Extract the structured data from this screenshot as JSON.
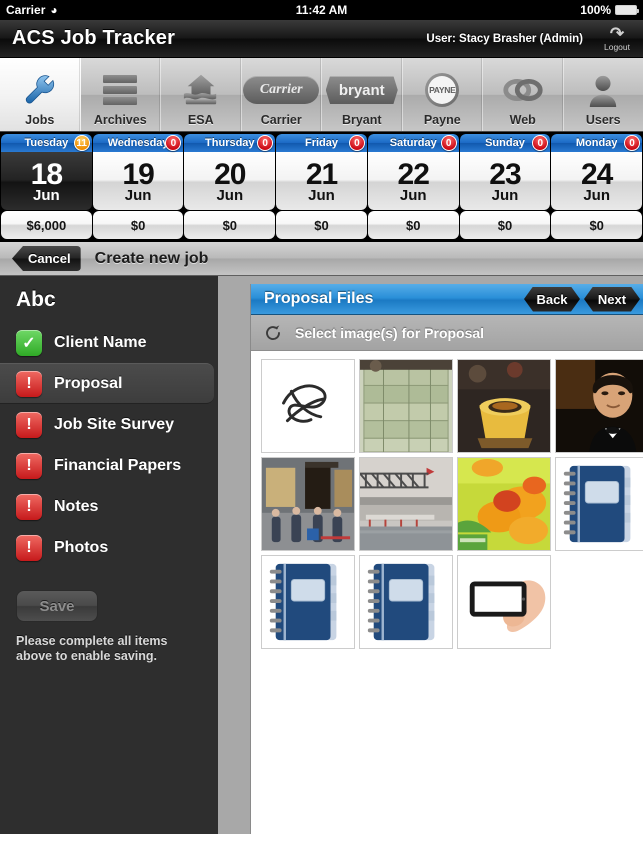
{
  "status_bar": {
    "carrier": "Carrier",
    "wifi_icon": "wifi-icon",
    "time": "11:42 AM",
    "battery_percent": "100%",
    "battery_icon": "battery-full-icon"
  },
  "app_bar": {
    "title": "ACS Job Tracker",
    "user": "User: Stacy Brasher (Admin)",
    "logout_label": "Logout",
    "logout_icon": "logout-icon"
  },
  "tabs": [
    {
      "label": "Jobs",
      "icon": "wrench-icon",
      "selected": true
    },
    {
      "label": "Archives",
      "icon": "archive-stack-icon",
      "selected": false
    },
    {
      "label": "ESA",
      "icon": "house-icon",
      "selected": false
    },
    {
      "label": "Carrier",
      "icon": "carrier-logo-icon",
      "selected": false,
      "logo_text": "Carrier"
    },
    {
      "label": "Bryant",
      "icon": "bryant-logo-icon",
      "selected": false,
      "logo_text": "bryant"
    },
    {
      "label": "Payne",
      "icon": "payne-logo-icon",
      "selected": false,
      "logo_text": "PAYNE"
    },
    {
      "label": "Web",
      "icon": "link-rings-icon",
      "selected": false
    },
    {
      "label": "Users",
      "icon": "person-icon",
      "selected": false
    }
  ],
  "days": [
    {
      "name": "Tuesday",
      "badge": "11",
      "badge_color": "#ef8f05",
      "num": "18",
      "month": "Jun",
      "amount": "$6,000",
      "active": true
    },
    {
      "name": "Wednesday",
      "badge": "0",
      "badge_color": "#cc0c17",
      "num": "19",
      "month": "Jun",
      "amount": "$0",
      "active": false
    },
    {
      "name": "Thursday",
      "badge": "0",
      "badge_color": "#cc0c17",
      "num": "20",
      "month": "Jun",
      "amount": "$0",
      "active": false
    },
    {
      "name": "Friday",
      "badge": "0",
      "badge_color": "#cc0c17",
      "num": "21",
      "month": "Jun",
      "amount": "$0",
      "active": false
    },
    {
      "name": "Saturday",
      "badge": "0",
      "badge_color": "#cc0c17",
      "num": "22",
      "month": "Jun",
      "amount": "$0",
      "active": false
    },
    {
      "name": "Sunday",
      "badge": "0",
      "badge_color": "#cc0c17",
      "num": "23",
      "month": "Jun",
      "amount": "$0",
      "active": false
    },
    {
      "name": "Monday",
      "badge": "0",
      "badge_color": "#cc0c17",
      "num": "24",
      "month": "Jun",
      "amount": "$0",
      "active": false
    }
  ],
  "toolbar": {
    "cancel_label": "Cancel",
    "screen_title": "Create new job"
  },
  "sidebar": {
    "title": "Abc",
    "items": [
      {
        "label": "Client Name",
        "state": "done",
        "icon": "check-icon",
        "selected": false
      },
      {
        "label": "Proposal",
        "state": "todo",
        "icon": "exclamation-icon",
        "selected": true
      },
      {
        "label": "Job Site Survey",
        "state": "todo",
        "icon": "exclamation-icon",
        "selected": false
      },
      {
        "label": "Financial Papers",
        "state": "todo",
        "icon": "exclamation-icon",
        "selected": false
      },
      {
        "label": "Notes",
        "state": "todo",
        "icon": "exclamation-icon",
        "selected": false
      },
      {
        "label": "Photos",
        "state": "todo",
        "icon": "exclamation-icon",
        "selected": false
      }
    ],
    "save_label": "Save",
    "save_hint": "Please complete all items above to enable saving."
  },
  "panel": {
    "title": "Proposal Files",
    "back_label": "Back",
    "next_label": "Next",
    "refresh_icon": "refresh-icon",
    "select_label": "Select image(s) for Proposal",
    "thumbnails": [
      {
        "name": "thumb-signature-scribble",
        "kind": "signature"
      },
      {
        "name": "thumb-stacked-banknotes",
        "kind": "money"
      },
      {
        "name": "thumb-yellow-bowl-food",
        "kind": "bowl"
      },
      {
        "name": "thumb-man-in-tuxedo",
        "kind": "portrait"
      },
      {
        "name": "thumb-hermes-storefront",
        "kind": "street"
      },
      {
        "name": "thumb-bridge-waterfront",
        "kind": "bridge"
      },
      {
        "name": "thumb-orange-food-closeup",
        "kind": "orangefood"
      },
      {
        "name": "thumb-blue-notebook-1",
        "kind": "notebook"
      },
      {
        "name": "thumb-blue-notebook-2",
        "kind": "notebook"
      },
      {
        "name": "thumb-blue-notebook-3",
        "kind": "notebook"
      },
      {
        "name": "thumb-hand-holding-phone",
        "kind": "phone"
      }
    ]
  }
}
